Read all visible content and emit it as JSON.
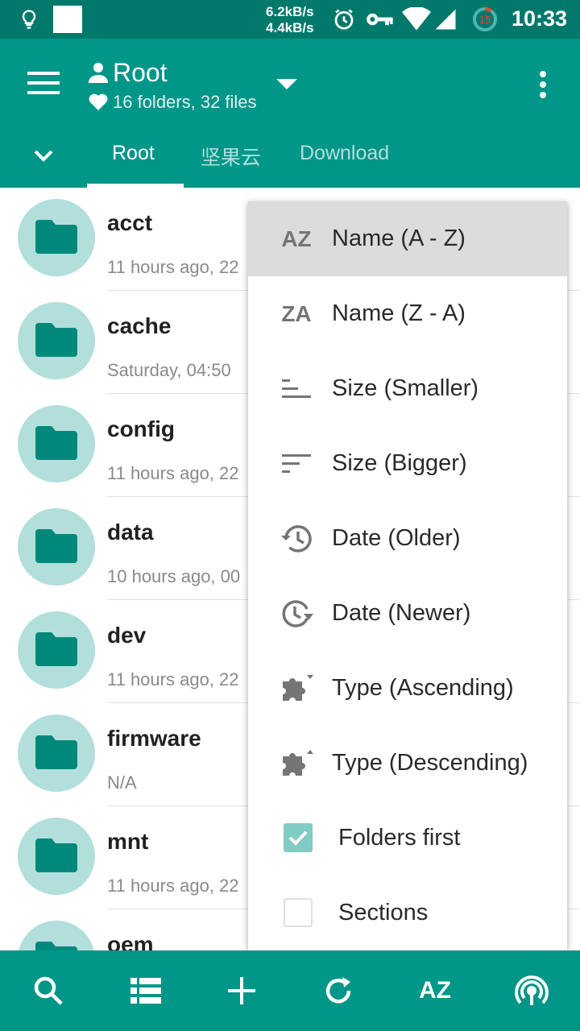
{
  "status_bar": {
    "speed_up": "6.2kB/s",
    "speed_down": "4.4kB/s",
    "battery_level": "15",
    "time": "10:33",
    "icons": [
      "bulb-icon",
      "notification-square-icon",
      "alarm-icon",
      "vpn-key-icon",
      "wifi-icon",
      "cell-signal-icon",
      "battery-icon"
    ]
  },
  "app_bar": {
    "title": "Root",
    "subtitle": "16 folders, 32 files",
    "tabs": [
      {
        "label": "Root",
        "active": true
      },
      {
        "label": "坚果云",
        "active": false
      },
      {
        "label": "Download",
        "active": false
      }
    ]
  },
  "files": [
    {
      "name": "acct",
      "meta": "11 hours ago, 22"
    },
    {
      "name": "cache",
      "meta": "Saturday, 04:50"
    },
    {
      "name": "config",
      "meta": "11 hours ago, 22"
    },
    {
      "name": "data",
      "meta": "10 hours ago, 00"
    },
    {
      "name": "dev",
      "meta": "11 hours ago, 22"
    },
    {
      "name": "firmware",
      "meta": "N/A"
    },
    {
      "name": "mnt",
      "meta": "11 hours ago, 22"
    },
    {
      "name": "oem",
      "meta": ""
    }
  ],
  "sort_menu": {
    "items": [
      {
        "icon": "az-icon",
        "icon_text": "AZ",
        "label": "Name (A - Z)",
        "highlighted": true
      },
      {
        "icon": "za-icon",
        "icon_text": "ZA",
        "label": "Name (Z - A)"
      },
      {
        "icon": "sort-ascending-bars-icon",
        "label": "Size (Smaller)"
      },
      {
        "icon": "sort-descending-bars-icon",
        "label": "Size (Bigger)"
      },
      {
        "icon": "history-icon",
        "label": "Date (Older)"
      },
      {
        "icon": "update-icon",
        "label": "Date (Newer)"
      },
      {
        "icon": "puzzle-down-icon",
        "label": "Type (Ascending)"
      },
      {
        "icon": "puzzle-up-icon",
        "label": "Type (Descending)"
      },
      {
        "icon": "checkbox-checked-icon",
        "label": "Folders first",
        "checked": true
      },
      {
        "icon": "checkbox-unchecked-icon",
        "label": "Sections",
        "checked": false
      }
    ]
  },
  "bottom_bar": {
    "az_label": "AZ",
    "icons": [
      "search-icon",
      "list-view-icon",
      "add-icon",
      "refresh-icon",
      "sort-az-icon",
      "broadcast-icon"
    ]
  },
  "colors": {
    "status_bar": "#00796b",
    "primary": "#009688",
    "avatar_bg": "#b2dfdb",
    "folder": "#00897b",
    "menu_highlight": "#dcdcdc",
    "checkbox_on": "#80cbc4"
  }
}
